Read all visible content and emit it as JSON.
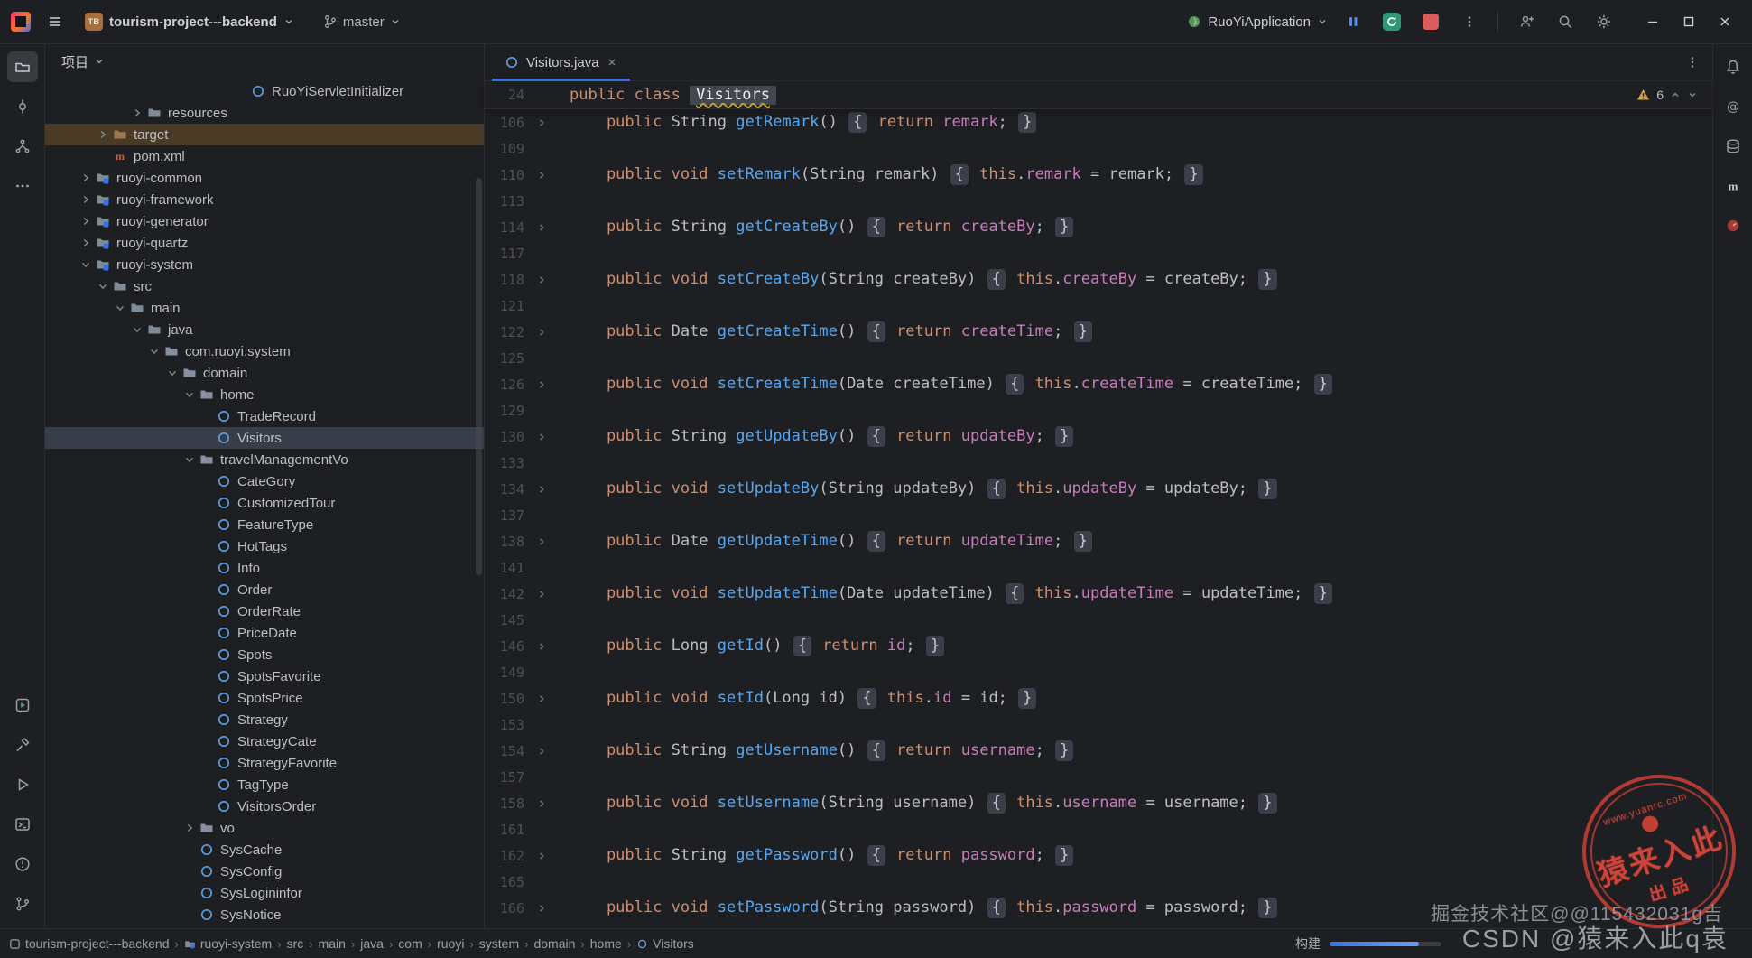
{
  "title_bar": {
    "project_badge": "TB",
    "project_name": "tourism-project---backend",
    "branch_name": "master",
    "run_config_name": "RuoYiApplication"
  },
  "activity_bar_left": {
    "top": [
      {
        "name": "project",
        "active": true
      },
      {
        "name": "commit"
      },
      {
        "name": "structure"
      },
      {
        "name": "more"
      }
    ],
    "bottom": [
      {
        "name": "services"
      },
      {
        "name": "build"
      },
      {
        "name": "run"
      },
      {
        "name": "terminal"
      },
      {
        "name": "problems"
      },
      {
        "name": "vcs"
      }
    ]
  },
  "activity_bar_right": [
    {
      "name": "notifications"
    },
    {
      "name": "ai-assistant"
    },
    {
      "name": "database"
    },
    {
      "name": "maven"
    },
    {
      "name": "profiler"
    }
  ],
  "project_panel": {
    "header": "项目",
    "tree": [
      {
        "label": "RuoYiServletInitializer",
        "level": 12,
        "icon": "class"
      },
      {
        "label": "resources",
        "level": 6,
        "icon": "folder",
        "chevron": "closed"
      },
      {
        "label": "target",
        "level": 4,
        "icon": "folder-target",
        "chevron": "closed",
        "state": "highlight"
      },
      {
        "label": "pom.xml",
        "level": 4,
        "icon": "maven"
      },
      {
        "label": "ruoyi-common",
        "level": 3,
        "icon": "module",
        "chevron": "closed"
      },
      {
        "label": "ruoyi-framework",
        "level": 3,
        "icon": "module",
        "chevron": "closed"
      },
      {
        "label": "ruoyi-generator",
        "level": 3,
        "icon": "module",
        "chevron": "closed"
      },
      {
        "label": "ruoyi-quartz",
        "level": 3,
        "icon": "module",
        "chevron": "closed"
      },
      {
        "label": "ruoyi-system",
        "level": 3,
        "icon": "module",
        "chevron": "open"
      },
      {
        "label": "src",
        "level": 4,
        "icon": "folder",
        "chevron": "open"
      },
      {
        "label": "main",
        "level": 5,
        "icon": "folder",
        "chevron": "open"
      },
      {
        "label": "java",
        "level": 6,
        "icon": "folder",
        "chevron": "open"
      },
      {
        "label": "com.ruoyi.system",
        "level": 7,
        "icon": "package",
        "chevron": "open"
      },
      {
        "label": "domain",
        "level": 8,
        "icon": "package",
        "chevron": "open"
      },
      {
        "label": "home",
        "level": 9,
        "icon": "package",
        "chevron": "open"
      },
      {
        "label": "TradeRecord",
        "level": 10,
        "icon": "class"
      },
      {
        "label": "Visitors",
        "level": 10,
        "icon": "class",
        "state": "selected"
      },
      {
        "label": "travelManagementVo",
        "level": 9,
        "icon": "package",
        "chevron": "open"
      },
      {
        "label": "CateGory",
        "level": 10,
        "icon": "class"
      },
      {
        "label": "CustomizedTour",
        "level": 10,
        "icon": "class"
      },
      {
        "label": "FeatureType",
        "level": 10,
        "icon": "class"
      },
      {
        "label": "HotTags",
        "level": 10,
        "icon": "class"
      },
      {
        "label": "Info",
        "level": 10,
        "icon": "class"
      },
      {
        "label": "Order",
        "level": 10,
        "icon": "class"
      },
      {
        "label": "OrderRate",
        "level": 10,
        "icon": "class"
      },
      {
        "label": "PriceDate",
        "level": 10,
        "icon": "class"
      },
      {
        "label": "Spots",
        "level": 10,
        "icon": "class"
      },
      {
        "label": "SpotsFavorite",
        "level": 10,
        "icon": "class"
      },
      {
        "label": "SpotsPrice",
        "level": 10,
        "icon": "class"
      },
      {
        "label": "Strategy",
        "level": 10,
        "icon": "class"
      },
      {
        "label": "StrategyCate",
        "level": 10,
        "icon": "class"
      },
      {
        "label": "StrategyFavorite",
        "level": 10,
        "icon": "class"
      },
      {
        "label": "TagType",
        "level": 10,
        "icon": "class"
      },
      {
        "label": "VisitorsOrder",
        "level": 10,
        "icon": "class"
      },
      {
        "label": "vo",
        "level": 9,
        "icon": "package",
        "chevron": "closed"
      },
      {
        "label": "SysCache",
        "level": 9,
        "icon": "class"
      },
      {
        "label": "SysConfig",
        "level": 9,
        "icon": "class"
      },
      {
        "label": "SysLogininfor",
        "level": 9,
        "icon": "class"
      },
      {
        "label": "SysNotice",
        "level": 9,
        "icon": "class"
      }
    ]
  },
  "editor": {
    "tab_title": "Visitors.java",
    "warning_count": "6",
    "sticky": {
      "n": 24,
      "t": [
        [
          "k",
          "public class "
        ],
        [
          "c",
          "Visitors"
        ]
      ]
    },
    "lines": [
      {
        "n": 106,
        "t": [
          [
            "k",
            "    public "
          ],
          [
            "p",
            "String "
          ],
          [
            "m",
            "getRemark"
          ],
          [
            "p",
            "() "
          ],
          [
            "f",
            "{"
          ],
          [
            "p",
            " "
          ],
          [
            "k",
            "return "
          ],
          [
            "d",
            "remark"
          ],
          [
            "p",
            "; "
          ],
          [
            "f",
            "}"
          ]
        ]
      },
      {
        "n": 109,
        "t": []
      },
      {
        "n": 110,
        "t": [
          [
            "k",
            "    public void "
          ],
          [
            "m",
            "setRemark"
          ],
          [
            "p",
            "(String remark) "
          ],
          [
            "f",
            "{"
          ],
          [
            "p",
            " "
          ],
          [
            "k",
            "this"
          ],
          [
            "p",
            "."
          ],
          [
            "d",
            "remark"
          ],
          [
            "p",
            " = remark; "
          ],
          [
            "f",
            "}"
          ]
        ]
      },
      {
        "n": 113,
        "t": []
      },
      {
        "n": 114,
        "t": [
          [
            "k",
            "    public "
          ],
          [
            "p",
            "String "
          ],
          [
            "m",
            "getCreateBy"
          ],
          [
            "p",
            "() "
          ],
          [
            "f",
            "{"
          ],
          [
            "p",
            " "
          ],
          [
            "k",
            "return "
          ],
          [
            "d",
            "createBy"
          ],
          [
            "p",
            "; "
          ],
          [
            "f",
            "}"
          ]
        ]
      },
      {
        "n": 117,
        "t": []
      },
      {
        "n": 118,
        "t": [
          [
            "k",
            "    public void "
          ],
          [
            "m",
            "setCreateBy"
          ],
          [
            "p",
            "(String createBy) "
          ],
          [
            "f",
            "{"
          ],
          [
            "p",
            " "
          ],
          [
            "k",
            "this"
          ],
          [
            "p",
            "."
          ],
          [
            "d",
            "createBy"
          ],
          [
            "p",
            " = createBy; "
          ],
          [
            "f",
            "}"
          ]
        ]
      },
      {
        "n": 121,
        "t": []
      },
      {
        "n": 122,
        "t": [
          [
            "k",
            "    public "
          ],
          [
            "p",
            "Date "
          ],
          [
            "m",
            "getCreateTime"
          ],
          [
            "p",
            "() "
          ],
          [
            "f",
            "{"
          ],
          [
            "p",
            " "
          ],
          [
            "k",
            "return "
          ],
          [
            "d",
            "createTime"
          ],
          [
            "p",
            "; "
          ],
          [
            "f",
            "}"
          ]
        ]
      },
      {
        "n": 125,
        "t": []
      },
      {
        "n": 126,
        "t": [
          [
            "k",
            "    public void "
          ],
          [
            "m",
            "setCreateTime"
          ],
          [
            "p",
            "(Date createTime) "
          ],
          [
            "f",
            "{"
          ],
          [
            "p",
            " "
          ],
          [
            "k",
            "this"
          ],
          [
            "p",
            "."
          ],
          [
            "d",
            "createTime"
          ],
          [
            "p",
            " = createTime; "
          ],
          [
            "f",
            "}"
          ]
        ]
      },
      {
        "n": 129,
        "t": []
      },
      {
        "n": 130,
        "t": [
          [
            "k",
            "    public "
          ],
          [
            "p",
            "String "
          ],
          [
            "m",
            "getUpdateBy"
          ],
          [
            "p",
            "() "
          ],
          [
            "f",
            "{"
          ],
          [
            "p",
            " "
          ],
          [
            "k",
            "return "
          ],
          [
            "d",
            "updateBy"
          ],
          [
            "p",
            "; "
          ],
          [
            "f",
            "}"
          ]
        ]
      },
      {
        "n": 133,
        "t": []
      },
      {
        "n": 134,
        "t": [
          [
            "k",
            "    public void "
          ],
          [
            "m",
            "setUpdateBy"
          ],
          [
            "p",
            "(String updateBy) "
          ],
          [
            "f",
            "{"
          ],
          [
            "p",
            " "
          ],
          [
            "k",
            "this"
          ],
          [
            "p",
            "."
          ],
          [
            "d",
            "updateBy"
          ],
          [
            "p",
            " = updateBy; "
          ],
          [
            "f",
            "}"
          ]
        ]
      },
      {
        "n": 137,
        "t": []
      },
      {
        "n": 138,
        "t": [
          [
            "k",
            "    public "
          ],
          [
            "p",
            "Date "
          ],
          [
            "m",
            "getUpdateTime"
          ],
          [
            "p",
            "() "
          ],
          [
            "f",
            "{"
          ],
          [
            "p",
            " "
          ],
          [
            "k",
            "return "
          ],
          [
            "d",
            "updateTime"
          ],
          [
            "p",
            "; "
          ],
          [
            "f",
            "}"
          ]
        ]
      },
      {
        "n": 141,
        "t": []
      },
      {
        "n": 142,
        "t": [
          [
            "k",
            "    public void "
          ],
          [
            "m",
            "setUpdateTime"
          ],
          [
            "p",
            "(Date updateTime) "
          ],
          [
            "f",
            "{"
          ],
          [
            "p",
            " "
          ],
          [
            "k",
            "this"
          ],
          [
            "p",
            "."
          ],
          [
            "d",
            "updateTime"
          ],
          [
            "p",
            " = updateTime; "
          ],
          [
            "f",
            "}"
          ]
        ]
      },
      {
        "n": 145,
        "t": []
      },
      {
        "n": 146,
        "t": [
          [
            "k",
            "    public "
          ],
          [
            "p",
            "Long "
          ],
          [
            "m",
            "getId"
          ],
          [
            "p",
            "() "
          ],
          [
            "f",
            "{"
          ],
          [
            "p",
            " "
          ],
          [
            "k",
            "return "
          ],
          [
            "d",
            "id"
          ],
          [
            "p",
            "; "
          ],
          [
            "f",
            "}"
          ]
        ]
      },
      {
        "n": 149,
        "t": []
      },
      {
        "n": 150,
        "t": [
          [
            "k",
            "    public void "
          ],
          [
            "m",
            "setId"
          ],
          [
            "p",
            "(Long id) "
          ],
          [
            "f",
            "{"
          ],
          [
            "p",
            " "
          ],
          [
            "k",
            "this"
          ],
          [
            "p",
            "."
          ],
          [
            "d",
            "id"
          ],
          [
            "p",
            " = id; "
          ],
          [
            "f",
            "}"
          ]
        ]
      },
      {
        "n": 153,
        "t": []
      },
      {
        "n": 154,
        "t": [
          [
            "k",
            "    public "
          ],
          [
            "p",
            "String "
          ],
          [
            "m",
            "getUsername"
          ],
          [
            "p",
            "() "
          ],
          [
            "f",
            "{"
          ],
          [
            "p",
            " "
          ],
          [
            "k",
            "return "
          ],
          [
            "d",
            "username"
          ],
          [
            "p",
            "; "
          ],
          [
            "f",
            "}"
          ]
        ]
      },
      {
        "n": 157,
        "t": []
      },
      {
        "n": 158,
        "t": [
          [
            "k",
            "    public void "
          ],
          [
            "m",
            "setUsername"
          ],
          [
            "p",
            "(String username) "
          ],
          [
            "f",
            "{"
          ],
          [
            "p",
            " "
          ],
          [
            "k",
            "this"
          ],
          [
            "p",
            "."
          ],
          [
            "d",
            "username"
          ],
          [
            "p",
            " = username; "
          ],
          [
            "f",
            "}"
          ]
        ]
      },
      {
        "n": 161,
        "t": []
      },
      {
        "n": 162,
        "t": [
          [
            "k",
            "    public "
          ],
          [
            "p",
            "String "
          ],
          [
            "m",
            "getPassword"
          ],
          [
            "p",
            "() "
          ],
          [
            "f",
            "{"
          ],
          [
            "p",
            " "
          ],
          [
            "k",
            "return "
          ],
          [
            "d",
            "password"
          ],
          [
            "p",
            "; "
          ],
          [
            "f",
            "}"
          ]
        ]
      },
      {
        "n": 165,
        "t": []
      },
      {
        "n": 166,
        "t": [
          [
            "k",
            "    public void "
          ],
          [
            "m",
            "setPassword"
          ],
          [
            "p",
            "(String password) "
          ],
          [
            "f",
            "{"
          ],
          [
            "p",
            " "
          ],
          [
            "k",
            "this"
          ],
          [
            "p",
            "."
          ],
          [
            "d",
            "password"
          ],
          [
            "p",
            " = password; "
          ],
          [
            "f",
            "}"
          ]
        ]
      }
    ]
  },
  "status_bar": {
    "breadcrumbs": [
      {
        "label": "tourism-project---backend",
        "icon": "project"
      },
      {
        "label": "ruoyi-system",
        "icon": "module"
      },
      {
        "label": "src"
      },
      {
        "label": "main"
      },
      {
        "label": "java"
      },
      {
        "label": "com"
      },
      {
        "label": "ruoyi"
      },
      {
        "label": "system"
      },
      {
        "label": "domain"
      },
      {
        "label": "home"
      },
      {
        "label": "Visitors",
        "icon": "class"
      }
    ],
    "build_label": "构建"
  },
  "watermarks": {
    "line1": "掘金技术社区@@115432031g吉",
    "line2": "CSDN @猿来入此q袁",
    "stamp": {
      "site": "www.yuanrc.com",
      "main": "猿来入此",
      "sub": "出品"
    }
  }
}
